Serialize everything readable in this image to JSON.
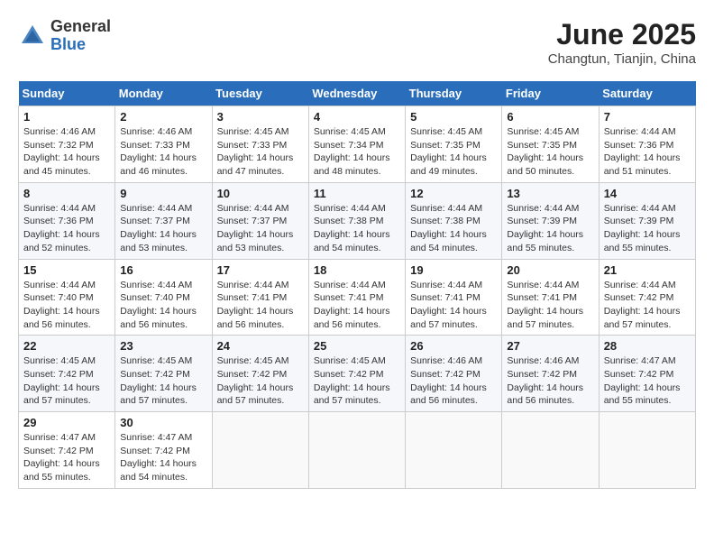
{
  "header": {
    "logo_general": "General",
    "logo_blue": "Blue",
    "month_title": "June 2025",
    "location": "Changtun, Tianjin, China"
  },
  "weekdays": [
    "Sunday",
    "Monday",
    "Tuesday",
    "Wednesday",
    "Thursday",
    "Friday",
    "Saturday"
  ],
  "weeks": [
    [
      {
        "day": "1",
        "sunrise": "4:46 AM",
        "sunset": "7:32 PM",
        "daylight": "14 hours and 45 minutes."
      },
      {
        "day": "2",
        "sunrise": "4:46 AM",
        "sunset": "7:33 PM",
        "daylight": "14 hours and 46 minutes."
      },
      {
        "day": "3",
        "sunrise": "4:45 AM",
        "sunset": "7:33 PM",
        "daylight": "14 hours and 47 minutes."
      },
      {
        "day": "4",
        "sunrise": "4:45 AM",
        "sunset": "7:34 PM",
        "daylight": "14 hours and 48 minutes."
      },
      {
        "day": "5",
        "sunrise": "4:45 AM",
        "sunset": "7:35 PM",
        "daylight": "14 hours and 49 minutes."
      },
      {
        "day": "6",
        "sunrise": "4:45 AM",
        "sunset": "7:35 PM",
        "daylight": "14 hours and 50 minutes."
      },
      {
        "day": "7",
        "sunrise": "4:44 AM",
        "sunset": "7:36 PM",
        "daylight": "14 hours and 51 minutes."
      }
    ],
    [
      {
        "day": "8",
        "sunrise": "4:44 AM",
        "sunset": "7:36 PM",
        "daylight": "14 hours and 52 minutes."
      },
      {
        "day": "9",
        "sunrise": "4:44 AM",
        "sunset": "7:37 PM",
        "daylight": "14 hours and 53 minutes."
      },
      {
        "day": "10",
        "sunrise": "4:44 AM",
        "sunset": "7:37 PM",
        "daylight": "14 hours and 53 minutes."
      },
      {
        "day": "11",
        "sunrise": "4:44 AM",
        "sunset": "7:38 PM",
        "daylight": "14 hours and 54 minutes."
      },
      {
        "day": "12",
        "sunrise": "4:44 AM",
        "sunset": "7:38 PM",
        "daylight": "14 hours and 54 minutes."
      },
      {
        "day": "13",
        "sunrise": "4:44 AM",
        "sunset": "7:39 PM",
        "daylight": "14 hours and 55 minutes."
      },
      {
        "day": "14",
        "sunrise": "4:44 AM",
        "sunset": "7:39 PM",
        "daylight": "14 hours and 55 minutes."
      }
    ],
    [
      {
        "day": "15",
        "sunrise": "4:44 AM",
        "sunset": "7:40 PM",
        "daylight": "14 hours and 56 minutes."
      },
      {
        "day": "16",
        "sunrise": "4:44 AM",
        "sunset": "7:40 PM",
        "daylight": "14 hours and 56 minutes."
      },
      {
        "day": "17",
        "sunrise": "4:44 AM",
        "sunset": "7:41 PM",
        "daylight": "14 hours and 56 minutes."
      },
      {
        "day": "18",
        "sunrise": "4:44 AM",
        "sunset": "7:41 PM",
        "daylight": "14 hours and 56 minutes."
      },
      {
        "day": "19",
        "sunrise": "4:44 AM",
        "sunset": "7:41 PM",
        "daylight": "14 hours and 57 minutes."
      },
      {
        "day": "20",
        "sunrise": "4:44 AM",
        "sunset": "7:41 PM",
        "daylight": "14 hours and 57 minutes."
      },
      {
        "day": "21",
        "sunrise": "4:44 AM",
        "sunset": "7:42 PM",
        "daylight": "14 hours and 57 minutes."
      }
    ],
    [
      {
        "day": "22",
        "sunrise": "4:45 AM",
        "sunset": "7:42 PM",
        "daylight": "14 hours and 57 minutes."
      },
      {
        "day": "23",
        "sunrise": "4:45 AM",
        "sunset": "7:42 PM",
        "daylight": "14 hours and 57 minutes."
      },
      {
        "day": "24",
        "sunrise": "4:45 AM",
        "sunset": "7:42 PM",
        "daylight": "14 hours and 57 minutes."
      },
      {
        "day": "25",
        "sunrise": "4:45 AM",
        "sunset": "7:42 PM",
        "daylight": "14 hours and 57 minutes."
      },
      {
        "day": "26",
        "sunrise": "4:46 AM",
        "sunset": "7:42 PM",
        "daylight": "14 hours and 56 minutes."
      },
      {
        "day": "27",
        "sunrise": "4:46 AM",
        "sunset": "7:42 PM",
        "daylight": "14 hours and 56 minutes."
      },
      {
        "day": "28",
        "sunrise": "4:47 AM",
        "sunset": "7:42 PM",
        "daylight": "14 hours and 55 minutes."
      }
    ],
    [
      {
        "day": "29",
        "sunrise": "4:47 AM",
        "sunset": "7:42 PM",
        "daylight": "14 hours and 55 minutes."
      },
      {
        "day": "30",
        "sunrise": "4:47 AM",
        "sunset": "7:42 PM",
        "daylight": "14 hours and 54 minutes."
      },
      null,
      null,
      null,
      null,
      null
    ]
  ]
}
